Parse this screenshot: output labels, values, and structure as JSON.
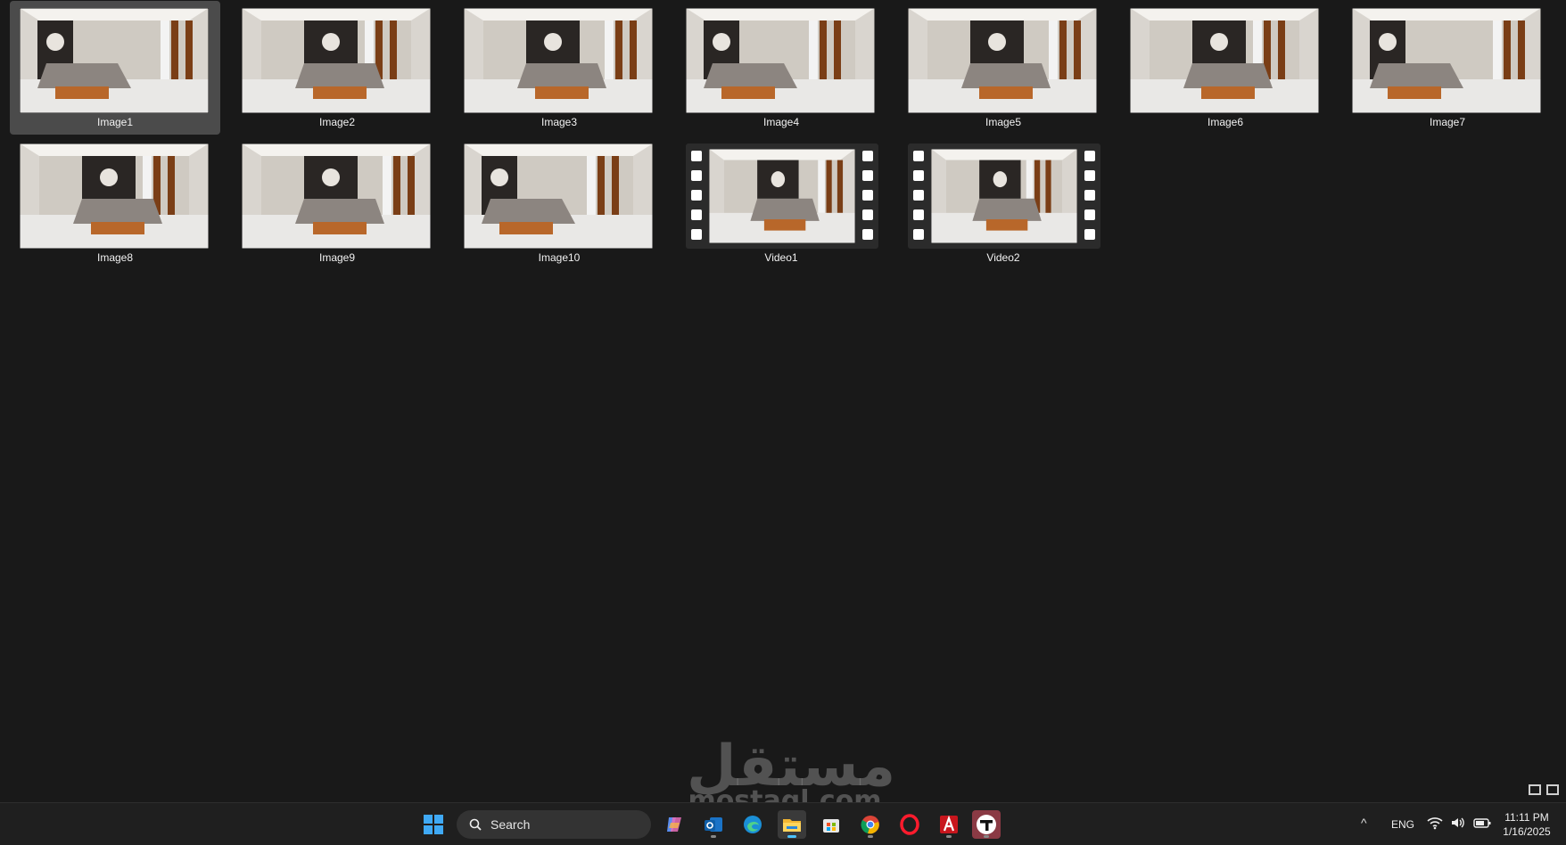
{
  "files": [
    {
      "name": "Image1",
      "type": "image",
      "selected": true
    },
    {
      "name": "Image2",
      "type": "image"
    },
    {
      "name": "Image3",
      "type": "image"
    },
    {
      "name": "Image4",
      "type": "image"
    },
    {
      "name": "Image5",
      "type": "image"
    },
    {
      "name": "Image6",
      "type": "image"
    },
    {
      "name": "Image7",
      "type": "image"
    },
    {
      "name": "Image8",
      "type": "image"
    },
    {
      "name": "Image9",
      "type": "image"
    },
    {
      "name": "Image10",
      "type": "image"
    },
    {
      "name": "Video1",
      "type": "video"
    },
    {
      "name": "Video2",
      "type": "video"
    }
  ],
  "watermark": {
    "arabic": "مستقل",
    "latin": "mostaql.com"
  },
  "taskbar": {
    "search_placeholder": "Search",
    "pinned": [
      "windows-start-icon",
      "copilot-icon",
      "outlook-icon",
      "edge-icon",
      "file-explorer-icon",
      "microsoft-store-icon",
      "chrome-icon",
      "opera-icon",
      "autocad-icon",
      "app-icon"
    ],
    "tray": {
      "language": "ENG",
      "time": "11:11 PM",
      "date": "1/16/2025"
    }
  },
  "colors": {
    "background": "#191919",
    "selection": "#4b4b4b",
    "taskbar": "#1f1f1f",
    "accent": "#4cc2ff"
  }
}
